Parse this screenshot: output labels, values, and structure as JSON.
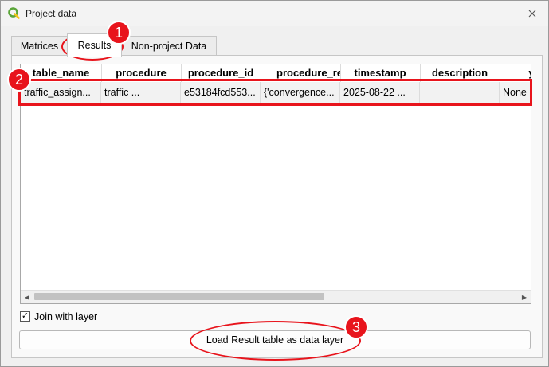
{
  "window": {
    "title": "Project data"
  },
  "tabs": [
    {
      "label": "Matrices"
    },
    {
      "label": "Results"
    },
    {
      "label": "Non-project Data"
    }
  ],
  "table": {
    "columns": [
      "table_name",
      "procedure",
      "procedure_id",
      "procedure_report",
      "timestamp",
      "description",
      "y"
    ],
    "rows": [
      [
        "traffic_assign...",
        "traffic ...",
        "e53184fcd553...",
        "{'convergence...",
        "2025-08-22 ...",
        "",
        "None"
      ]
    ]
  },
  "join_with_layer": {
    "label": "Join with layer",
    "checked": true
  },
  "load_button": {
    "label": "Load Result table as data layer"
  },
  "annotations": [
    {
      "number": "1"
    },
    {
      "number": "2"
    },
    {
      "number": "3"
    }
  ],
  "colors": {
    "annotation": "#e8141c",
    "app_icon": "#5aa538"
  }
}
